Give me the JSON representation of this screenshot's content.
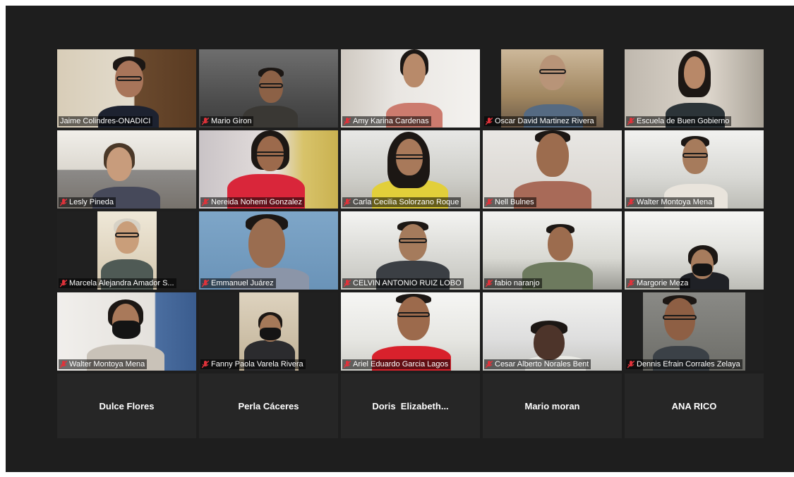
{
  "meeting": {
    "active_speaker_border": "#c5d93a",
    "mic_muted_color": "#e0323a",
    "mic_icon": "mic-muted-icon"
  },
  "participants": [
    {
      "name": "Jaime Colindres-ONADICI",
      "muted": false,
      "active": true
    },
    {
      "name": "Mario Giron",
      "muted": true
    },
    {
      "name": "Amy Karina Cardenas",
      "muted": true
    },
    {
      "name": "Oscar David Martinez Rivera",
      "muted": true
    },
    {
      "name": "Escuela de Buen Gobierno",
      "muted": true
    },
    {
      "name": "Lesly Pineda",
      "muted": true
    },
    {
      "name": "Nereida Nohemi Gonzalez",
      "muted": true
    },
    {
      "name": "Carla Cecilia Solorzano Roque",
      "muted": true
    },
    {
      "name": "Nell Bulnes",
      "muted": true
    },
    {
      "name": "Walter Montoya Mena",
      "muted": true
    },
    {
      "name": "Marcela Alejandra Amador S...",
      "muted": true
    },
    {
      "name": "Emmanuel Juárez",
      "muted": true
    },
    {
      "name": "CELVIN ANTONIO RUIZ LOBO",
      "muted": true
    },
    {
      "name": "fabio naranjo",
      "muted": true
    },
    {
      "name": "Margorie Meza",
      "muted": true
    },
    {
      "name": "Walter Montoya Mena",
      "muted": true
    },
    {
      "name": "Fanny Paola Varela Rivera",
      "muted": true
    },
    {
      "name": "Ariel Eduardo Garcia Lagos",
      "muted": true
    },
    {
      "name": "Cesar Alberto Norales Bent",
      "muted": true
    },
    {
      "name": "Dennis Efrain Corrales Zelaya",
      "muted": true
    }
  ],
  "no_video_participants": [
    {
      "name": "Dulce Flores"
    },
    {
      "name": "Perla Cáceres"
    },
    {
      "name": "Doris  Elizabeth..."
    },
    {
      "name": "Mario moran"
    },
    {
      "name": "ANA RICO"
    }
  ]
}
